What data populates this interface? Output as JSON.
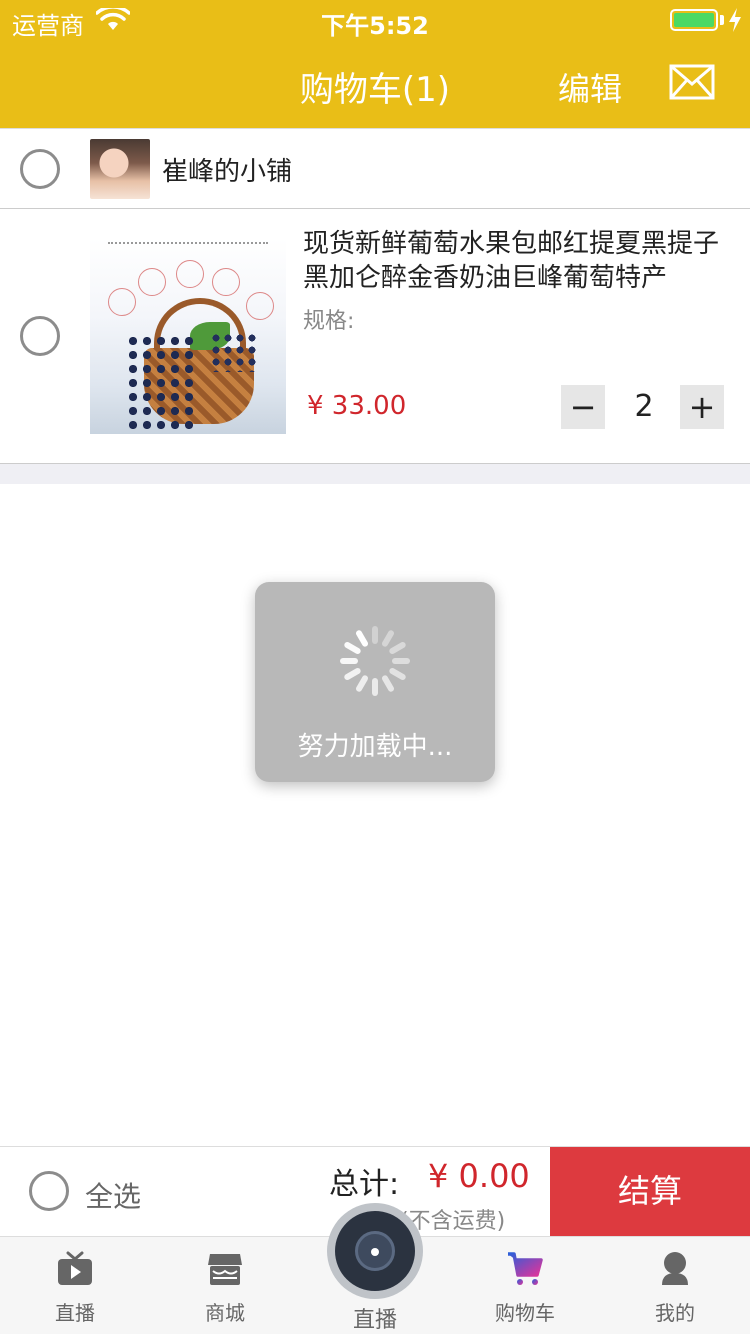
{
  "status_bar": {
    "carrier": "运营商",
    "time": "下午5:52"
  },
  "nav": {
    "title": "购物车(1)",
    "edit": "编辑"
  },
  "store": {
    "name": "崔峰的小铺"
  },
  "item": {
    "title": "现货新鲜葡萄水果包邮红提夏黑提子黑加仑醉金香奶油巨峰葡萄特产",
    "spec_label": "规格:",
    "price": "¥ 33.00",
    "quantity": "2",
    "minus": "−",
    "plus": "+"
  },
  "loading": {
    "text": "努力加载中..."
  },
  "checkout": {
    "select_all": "全选",
    "total_label": "总计:",
    "total_value": "¥ 0.00",
    "shipping_note": "(不含运费)",
    "button": "结算"
  },
  "tabbar": {
    "tabs": [
      {
        "label": "直播",
        "icon": "tv-play-icon",
        "active": false
      },
      {
        "label": "商城",
        "icon": "store-icon",
        "active": false
      },
      {
        "label": "直播",
        "icon": "camera-icon",
        "active": false
      },
      {
        "label": "购物车",
        "icon": "cart-icon",
        "active": true
      },
      {
        "label": "我的",
        "icon": "person-icon",
        "active": false
      }
    ]
  },
  "colors": {
    "header": "#e9be17",
    "price_red": "#d0262c",
    "checkout_button": "#dd3a3f",
    "active_tab": "#2b5fd9"
  }
}
